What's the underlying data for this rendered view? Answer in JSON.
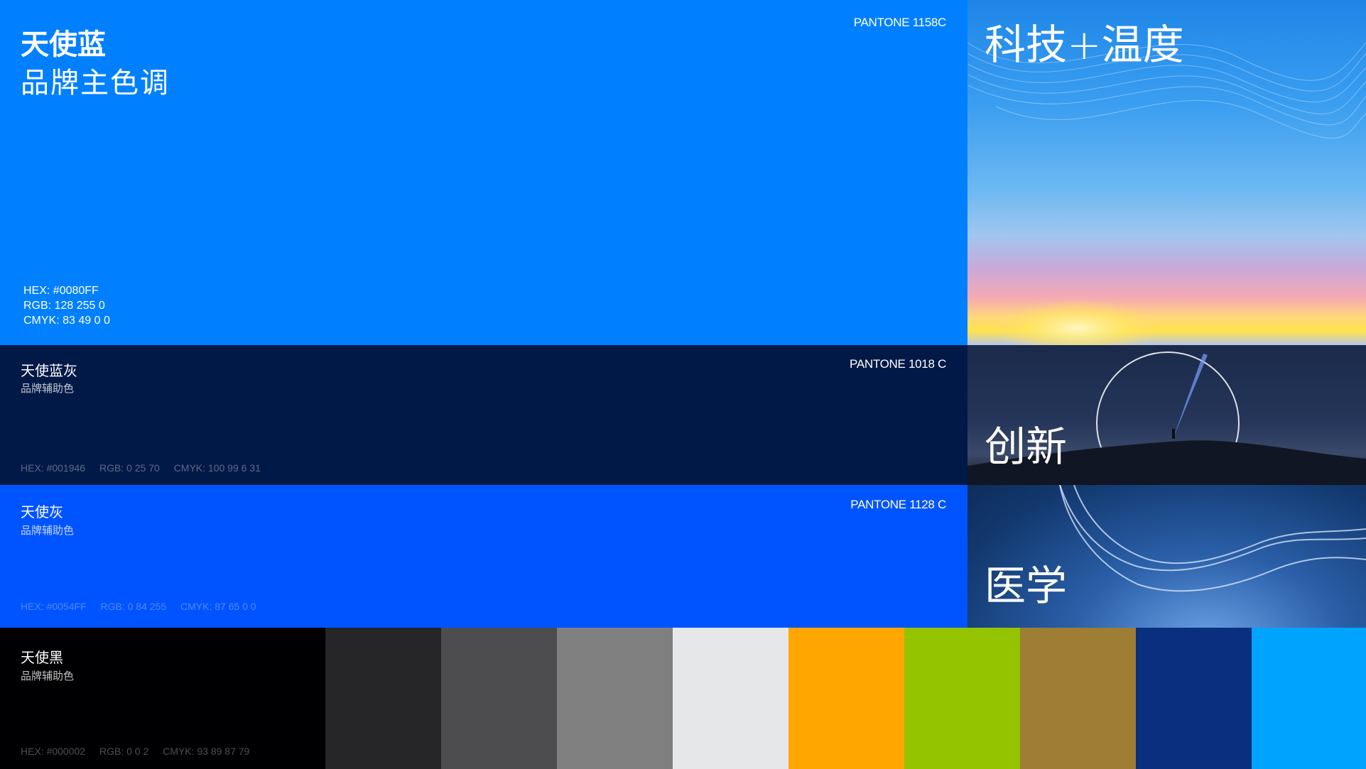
{
  "primary": {
    "name": "天使蓝",
    "subtitle": "品牌主色调",
    "pantone": "PANTONE 1158C",
    "hex": "HEX: #0080FF",
    "rgb": "RGB: 128 255 0",
    "cmyk": "CMYK: 83 49 0 0",
    "color": "#0080FF"
  },
  "secondary_1": {
    "name": "天使蓝灰",
    "subtitle": "品牌辅助色",
    "pantone": "PANTONE 1018 C",
    "hex": "HEX: #001946",
    "rgb": "RGB: 0 25 70",
    "cmyk": "CMYK: 100 99 6 31",
    "color": "#011946"
  },
  "secondary_2": {
    "name": "天使灰",
    "subtitle": "品牌辅助色",
    "pantone": "PANTONE 1128 C",
    "hex": "HEX: #0054FF",
    "rgb": "RGB: 0 84 255",
    "cmyk": "CMYK: 87 65 0 0",
    "color": "#0054FF"
  },
  "secondary_3": {
    "name": "天使黑",
    "subtitle": "品牌辅助色",
    "hex": "HEX: #000002",
    "rgb": "RGB: 0 0 2",
    "cmyk": "CMYK: 93 89 87 79",
    "color": "#000002"
  },
  "images": {
    "img1_label": "科技+温度",
    "img2_label": "创新",
    "img3_label": "医学"
  },
  "swatches": [
    "#262628",
    "#4d4d4f",
    "#808080",
    "#e6e7e8",
    "#ffa600",
    "#94c400",
    "#9e7d35",
    "#0a2f7e",
    "#00a4ff"
  ]
}
